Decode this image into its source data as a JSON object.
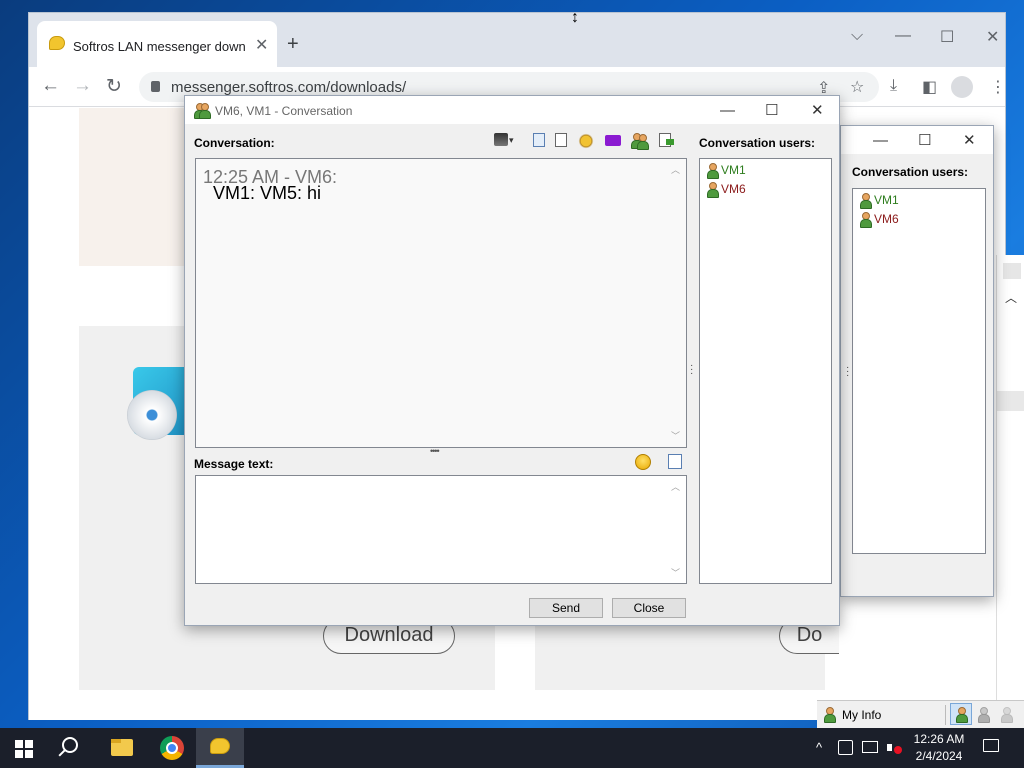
{
  "browser": {
    "tab_title": "Softros LAN messenger downlo",
    "new_tab": "+",
    "tab_close": "✕",
    "url": "messenger.softros.com/downloads/",
    "window_controls": {
      "minimize": "—",
      "maximize": "☐",
      "close": "✕",
      "dropdown": "⌵"
    },
    "nav": {
      "back": "←",
      "forward": "→",
      "reload": "↻"
    },
    "toolbar_icons": {
      "share": "⇪",
      "star": "☆",
      "download": "⤓",
      "sidepanel": "◧",
      "menu": "⋮"
    },
    "page": {
      "download_label_1": "Download",
      "download_label_2": "Do"
    }
  },
  "conversation_window": {
    "title": "VM6, VM1 - Conversation",
    "conversation_label": "Conversation:",
    "messages": [
      {
        "header": "12:25 AM - VM6:",
        "text": "VM1: VM5: hi"
      }
    ],
    "message_text_label": "Message text:",
    "message_value": "",
    "users_label": "Conversation users:",
    "users": [
      {
        "name": "VM1",
        "color": "#2e7d1e"
      },
      {
        "name": "VM6",
        "color": "#8b1a1a"
      }
    ],
    "send_button": "Send",
    "close_button": "Close",
    "splitter_dots": "••••",
    "controls": {
      "minimize": "—",
      "maximize": "☐",
      "close": "✕"
    }
  },
  "back_window": {
    "users_label": "Conversation users:",
    "users": [
      {
        "name": "VM1",
        "color": "#2e7d1e"
      },
      {
        "name": "VM6",
        "color": "#8b1a1a"
      }
    ],
    "controls": {
      "minimize": "—",
      "maximize": "☐",
      "close": "✕"
    }
  },
  "status_panel": {
    "my_info": "My Info"
  },
  "taskbar": {
    "time": "12:26 AM",
    "date": "2/4/2024",
    "tray_chevron": "^",
    "start_icon": "windows-start-icon",
    "search_icon": "search-icon",
    "explorer_icon": "file-explorer-icon",
    "chrome_icon": "chrome-icon",
    "messenger_icon": "softros-messenger-icon"
  }
}
